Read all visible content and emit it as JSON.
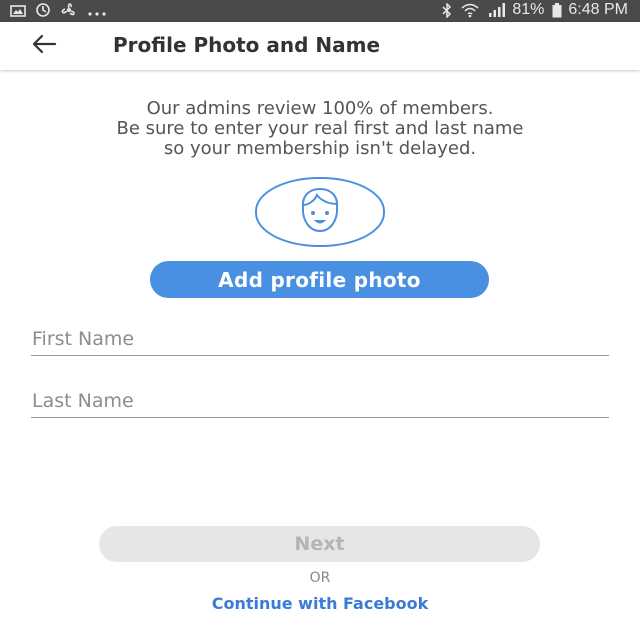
{
  "status_bar": {
    "left_icons": [
      "image-icon",
      "sync-icon",
      "fan-icon",
      "more-dots-icon"
    ],
    "battery_percent": "81%",
    "time": "6:48 PM",
    "right_icons": [
      "bluetooth-icon",
      "wifi-icon",
      "signal-icon",
      "battery-icon"
    ]
  },
  "app_bar": {
    "back_icon": "arrow-left-icon",
    "title": "Profile Photo and Name"
  },
  "intro": {
    "lines": [
      "Our admins review 100% of members.",
      "Be sure to enter your real first and last name",
      "so your membership isn't delayed."
    ]
  },
  "avatar": {
    "icon": "face-icon"
  },
  "add_photo": {
    "label": "Add profile photo"
  },
  "form": {
    "first_name": {
      "placeholder": "First Name",
      "value": ""
    },
    "last_name": {
      "placeholder": "Last Name",
      "value": ""
    }
  },
  "actions": {
    "next_label": "Next",
    "or_label": "OR",
    "facebook_label": "Continue with Facebook"
  },
  "colors": {
    "accent": "#4a90e2",
    "link": "#3b7bd4",
    "status_bar": "#4a4a4a",
    "disabled_button": "#e6e6e6"
  }
}
